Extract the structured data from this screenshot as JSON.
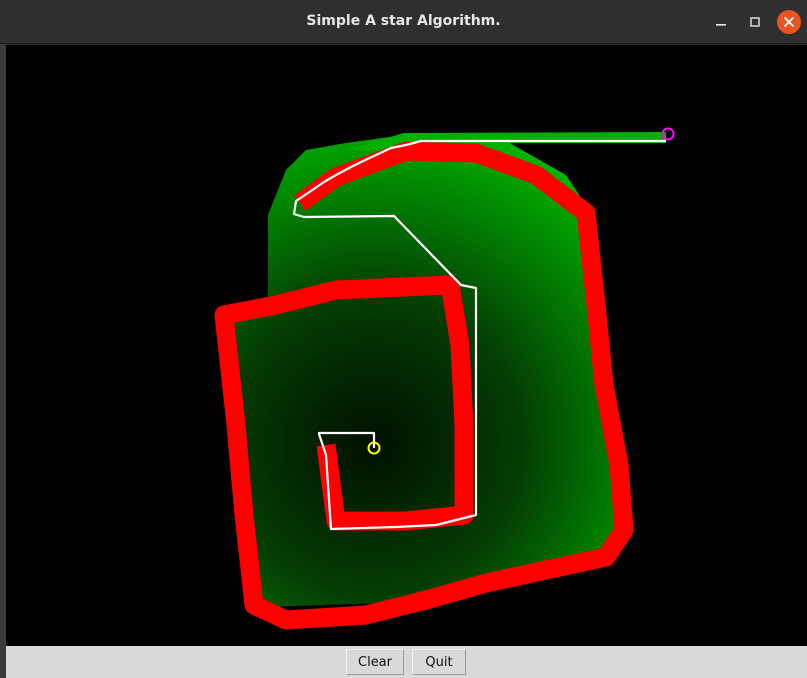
{
  "window": {
    "title": "Simple A star Algorithm."
  },
  "controls": {
    "minimize_icon": "minimize-icon",
    "maximize_icon": "maximize-icon",
    "close_icon": "close-icon"
  },
  "buttons": {
    "clear_label": "Clear",
    "quit_label": "Quit"
  },
  "colors": {
    "wall": "#ff0000",
    "explored_bright": "#00b000",
    "explored_dark": "#002500",
    "path": "#ffffff",
    "start_marker": "#ffff00",
    "goal_marker": "#ff00ff",
    "close_button": "#e95420"
  }
}
